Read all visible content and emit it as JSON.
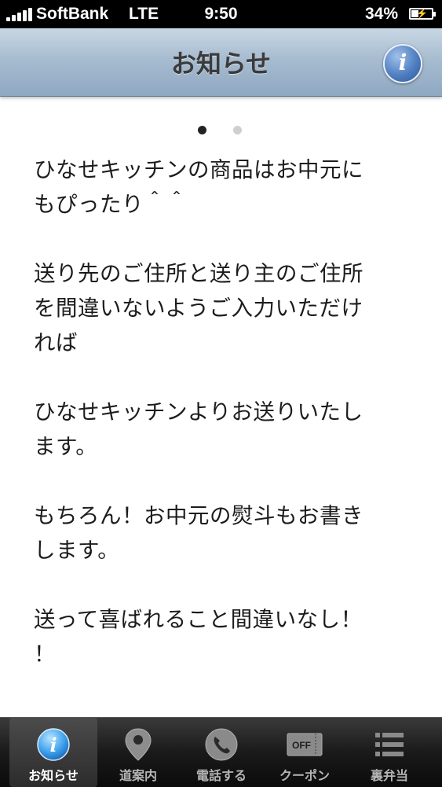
{
  "status_bar": {
    "carrier": "SoftBank",
    "network": "LTE",
    "time": "9:50",
    "battery_percent": "34%",
    "battery_level": 0.34
  },
  "nav": {
    "title": "お知らせ",
    "info_icon": "info-icon"
  },
  "pager": {
    "page_count": 2,
    "current_page": 1
  },
  "message": {
    "paragraphs": [
      "ひなせキッチンの商品はお中元にもぴったり＾＾",
      "送り先のご住所と送り主のご住所を間違いないようご入力いただければ",
      "ひなせキッチンよりお送りいたします。",
      "もちろん！お中元の熨斗もお書きします。",
      "送って喜ばれること間違いなし！！"
    ],
    "lines": [
      "ひなせキッチンの商品はお中元に",
      "もぴったり＾＾",
      "",
      "送り先のご住所と送り主のご住所",
      "を間違いないようご入力いただけ",
      "れば",
      "",
      "ひなせキッチンよりお送りいたし",
      "ます。",
      "",
      "もちろん！お中元の熨斗もお書き",
      "します。",
      "",
      "送って喜ばれること間違いなし！",
      "！"
    ]
  },
  "tab_bar": {
    "selected": "お知らせ",
    "tabs": [
      {
        "label": "お知らせ",
        "icon": "info-icon"
      },
      {
        "label": "道案内",
        "icon": "map-pin-icon"
      },
      {
        "label": "電話する",
        "icon": "phone-icon"
      },
      {
        "label": "クーポン",
        "icon": "coupon-off-icon",
        "icon_text": "OFF"
      },
      {
        "label": "裏弁当",
        "icon": "list-icon"
      }
    ]
  },
  "colors": {
    "nav_bar": "#a7bcd0",
    "info_button": "#4f7fc0",
    "tab_bar": "#1a1a1a",
    "text": "#1c1c1c"
  }
}
